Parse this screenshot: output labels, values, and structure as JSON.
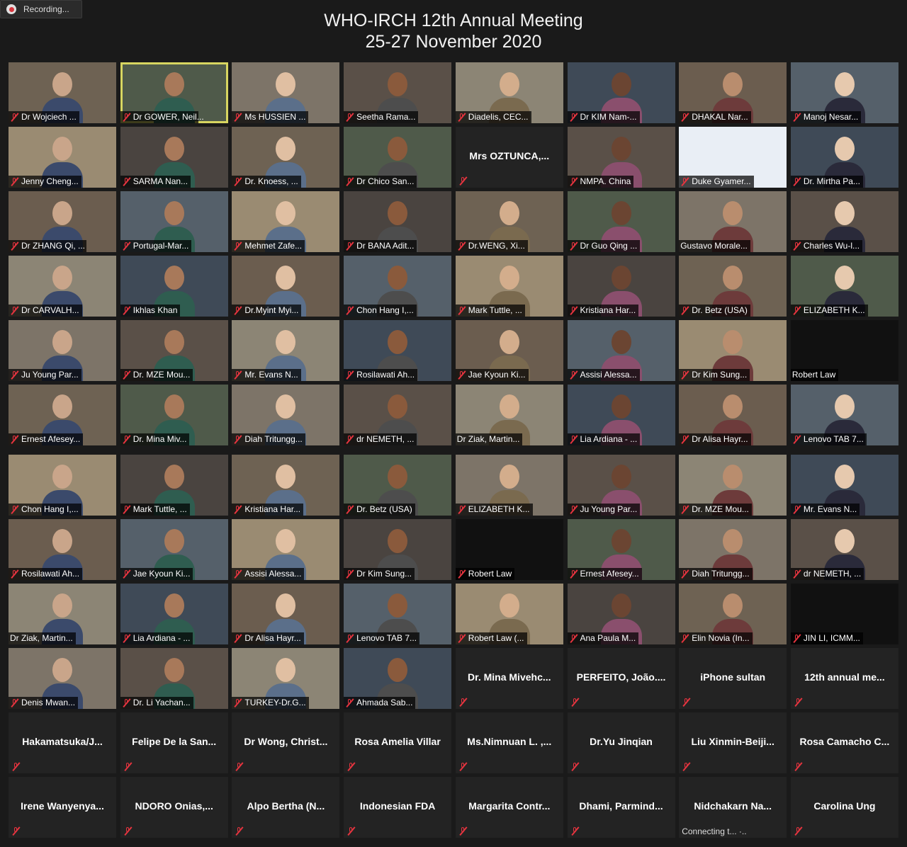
{
  "recording": {
    "label": "Recording..."
  },
  "meeting": {
    "title_line1": "WHO-IRCH 12th Annual Meeting",
    "title_line2": "25-27 November 2020"
  },
  "colors": {
    "active_border": "#d7d560",
    "muted_mic": "#e7343f",
    "tile_bg": "#232323",
    "page_bg": "#1a1a1a"
  },
  "tiles": [
    {
      "name": "Dr Wojciech ...",
      "video": true
    },
    {
      "name": "Dr GOWER, Neil...",
      "video": true,
      "active": true
    },
    {
      "name": "Ms HUSSIEN ...",
      "video": true
    },
    {
      "name": "Seetha Rama...",
      "video": true
    },
    {
      "name": "Diadelis, CEC...",
      "video": true
    },
    {
      "name": "Dr KIM Nam-...",
      "video": true
    },
    {
      "name": "DHAKAL Nar...",
      "video": true
    },
    {
      "name": "Manoj Nesar...",
      "video": true
    },
    {
      "name": "Jenny Cheng...",
      "video": true
    },
    {
      "name": "SARMA Nan...",
      "video": true
    },
    {
      "name": "Dr. Knoess, ...",
      "video": true
    },
    {
      "name": "Dr Chico San...",
      "video": true
    },
    {
      "name": "Mrs  OZTUNCA,...",
      "video": false
    },
    {
      "name": "NMPA. China",
      "video": true
    },
    {
      "name": "Duke Gyamer...",
      "video": true,
      "slide": true
    },
    {
      "name": "Dr. Mirtha Pa...",
      "video": true
    },
    {
      "name": "Dr ZHANG Qi, ...",
      "video": true
    },
    {
      "name": "Portugal-Mar...",
      "video": true
    },
    {
      "name": "Mehmet Zafe...",
      "video": true
    },
    {
      "name": "Dr BANA Adit...",
      "video": true
    },
    {
      "name": "Dr.WENG, Xi...",
      "video": true
    },
    {
      "name": "Dr Guo Qing ...",
      "video": true
    },
    {
      "name": "Gustavo Morale...",
      "video": true,
      "nomic": true
    },
    {
      "name": "Charles Wu-l...",
      "video": true
    },
    {
      "name": "Dr CARVALH...",
      "video": true
    },
    {
      "name": "Ikhlas Khan",
      "video": true
    },
    {
      "name": "Dr.Myint Myi...",
      "video": true
    },
    {
      "name": "Chon Hang I,...",
      "video": true
    },
    {
      "name": "Mark Tuttle, ...",
      "video": true
    },
    {
      "name": "Kristiana Har...",
      "video": true
    },
    {
      "name": "Dr. Betz (USA)",
      "video": true
    },
    {
      "name": "ELIZABETH K...",
      "video": true
    },
    {
      "name": "Ju Young Par...",
      "video": true
    },
    {
      "name": "Dr. MZE Mou...",
      "video": true
    },
    {
      "name": "Mr. Evans N...",
      "video": true
    },
    {
      "name": "Rosilawati Ah...",
      "video": true
    },
    {
      "name": "Jae Kyoun Ki...",
      "video": true
    },
    {
      "name": "Assisi Alessa...",
      "video": true
    },
    {
      "name": "Dr Kim Sung...",
      "video": true
    },
    {
      "name": "Robert Law",
      "video": true,
      "dark": true,
      "nomic": true
    },
    {
      "name": "Ernest Afesey...",
      "video": true
    },
    {
      "name": "Dr. Mina Miv...",
      "video": true
    },
    {
      "name": "Diah Tritungg...",
      "video": true
    },
    {
      "name": "dr NEMETH, ...",
      "video": true
    },
    {
      "name": "Dr Ziak, Martin...",
      "video": true,
      "nomic": true
    },
    {
      "name": "Lia Ardiana - ...",
      "video": true
    },
    {
      "name": "Dr Alisa Hayr...",
      "video": true
    },
    {
      "name": "Lenovo TAB 7...",
      "video": true
    },
    {
      "name": "Chon Hang I,...",
      "video": true
    },
    {
      "name": "Mark Tuttle, ...",
      "video": true
    },
    {
      "name": "Kristiana Har...",
      "video": true
    },
    {
      "name": "Dr. Betz (USA)",
      "video": true
    },
    {
      "name": "ELIZABETH K...",
      "video": true
    },
    {
      "name": "Ju Young Par...",
      "video": true
    },
    {
      "name": "Dr. MZE Mou...",
      "video": true
    },
    {
      "name": "Mr. Evans N...",
      "video": true
    },
    {
      "name": "Rosilawati Ah...",
      "video": true
    },
    {
      "name": "Jae Kyoun Ki...",
      "video": true
    },
    {
      "name": "Assisi Alessa...",
      "video": true
    },
    {
      "name": "Dr Kim Sung...",
      "video": true
    },
    {
      "name": "Robert Law",
      "video": true,
      "dark": true
    },
    {
      "name": "Ernest Afesey...",
      "video": true
    },
    {
      "name": "Diah Tritungg...",
      "video": true
    },
    {
      "name": "dr NEMETH, ...",
      "video": true
    },
    {
      "name": "Dr Ziak, Martin...",
      "video": true,
      "nomic": true
    },
    {
      "name": "Lia Ardiana - ...",
      "video": true
    },
    {
      "name": "Dr Alisa Hayr...",
      "video": true
    },
    {
      "name": "Lenovo TAB 7...",
      "video": true
    },
    {
      "name": "Robert Law (...",
      "video": true
    },
    {
      "name": "Ana Paula M...",
      "video": true
    },
    {
      "name": "Elin Novia (In...",
      "video": true
    },
    {
      "name": "JIN LI,  ICMM...",
      "video": true,
      "dark": true
    },
    {
      "name": "Denis Mwan...",
      "video": true
    },
    {
      "name": "Dr. Li Yachan...",
      "video": true
    },
    {
      "name": "TURKEY-Dr.G...",
      "video": true
    },
    {
      "name": "Ahmada Sab...",
      "video": true
    },
    {
      "name": "Dr.  Mina Mivehc...",
      "video": false
    },
    {
      "name": "PERFEITO,  João....",
      "video": false
    },
    {
      "name": "iPhone sultan",
      "video": false
    },
    {
      "name": "12th annual me...",
      "video": false
    },
    {
      "name": "Hakamatsuka/J...",
      "video": false
    },
    {
      "name": "Felipe De la San...",
      "video": false
    },
    {
      "name": "Dr Wong,  Christ...",
      "video": false
    },
    {
      "name": "Rosa Amelia Villar",
      "video": false
    },
    {
      "name": "Ms.Nimnuan L. ,...",
      "video": false
    },
    {
      "name": "Dr.Yu Jinqian",
      "video": false
    },
    {
      "name": "Liu  Xinmin-Beiji...",
      "video": false
    },
    {
      "name": "Rosa Camacho C...",
      "video": false
    },
    {
      "name": "Irene  Wanyenya...",
      "video": false
    },
    {
      "name": "NDORO  Onias,...",
      "video": false
    },
    {
      "name": "Alpo Bertha (N...",
      "video": false
    },
    {
      "name": "Indonesian FDA",
      "video": false
    },
    {
      "name": "Margarita  Contr...",
      "video": false
    },
    {
      "name": "Dhami,  Parmind...",
      "video": false
    },
    {
      "name": "Nidchakarn  Na...",
      "video": false,
      "status": "Connecting t... ·.."
    },
    {
      "name": "Carolina Ung",
      "video": false
    }
  ]
}
